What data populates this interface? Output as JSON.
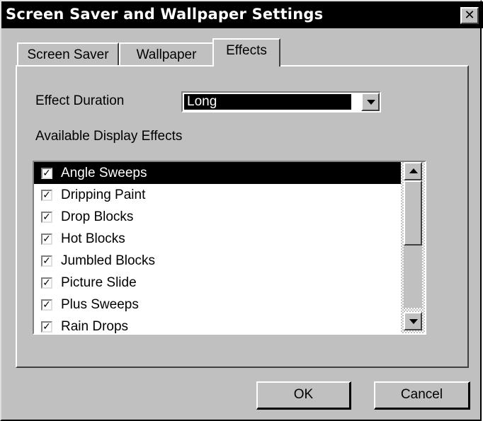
{
  "window": {
    "title": "Screen Saver and Wallpaper Settings",
    "close_glyph": "✕"
  },
  "tabs": [
    {
      "label": "Screen Saver",
      "active": false
    },
    {
      "label": "Wallpaper",
      "active": false
    },
    {
      "label": "Effects",
      "active": true
    }
  ],
  "effects": {
    "duration_label": "Effect Duration",
    "duration_value": "Long",
    "available_label": "Available Display Effects",
    "items": [
      {
        "label": "Angle Sweeps",
        "checked": true,
        "selected": true
      },
      {
        "label": "Dripping Paint",
        "checked": true,
        "selected": false
      },
      {
        "label": "Drop Blocks",
        "checked": true,
        "selected": false
      },
      {
        "label": "Hot Blocks",
        "checked": true,
        "selected": false
      },
      {
        "label": "Jumbled Blocks",
        "checked": true,
        "selected": false
      },
      {
        "label": "Picture Slide",
        "checked": true,
        "selected": false
      },
      {
        "label": "Plus Sweeps",
        "checked": true,
        "selected": false
      },
      {
        "label": "Rain Drops",
        "checked": true,
        "selected": false
      }
    ],
    "check_glyph": "✓"
  },
  "buttons": {
    "ok": "OK",
    "cancel": "Cancel"
  },
  "icons": {
    "close": "close-icon",
    "dropdown": "chevron-down-icon",
    "scroll_up": "arrow-up-icon",
    "scroll_down": "arrow-down-icon",
    "checkbox": "checkmark-icon"
  },
  "colors": {
    "dialog_bg": "#c0c0c0",
    "title_bg": "#000000",
    "selection_bg": "#000000",
    "selection_text": "#ffffff"
  }
}
